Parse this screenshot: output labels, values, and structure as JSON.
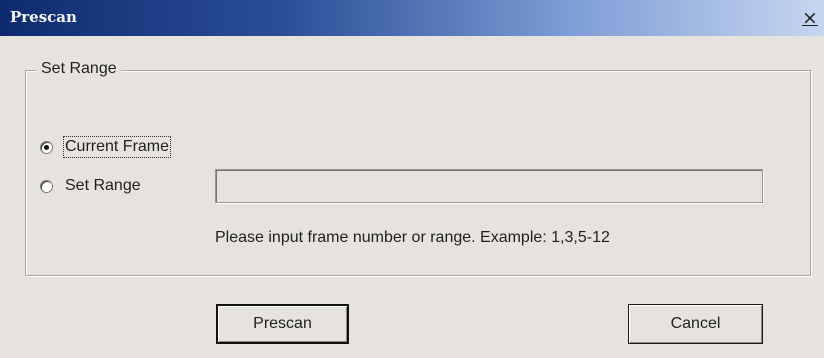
{
  "window": {
    "title": "Prescan",
    "close_glyph": "×"
  },
  "group": {
    "legend": "Set Range"
  },
  "options": {
    "current_frame_label": "Current Frame",
    "set_range_label": "Set Range",
    "selected": "current_frame"
  },
  "range_input": {
    "value": "",
    "placeholder": ""
  },
  "hint_text": "Please input frame number or range. Example: 1,3,5-12",
  "buttons": {
    "prescan_label": "Prescan",
    "cancel_label": "Cancel"
  },
  "icons": {
    "close": "close-icon",
    "radio": "radio-icon"
  }
}
